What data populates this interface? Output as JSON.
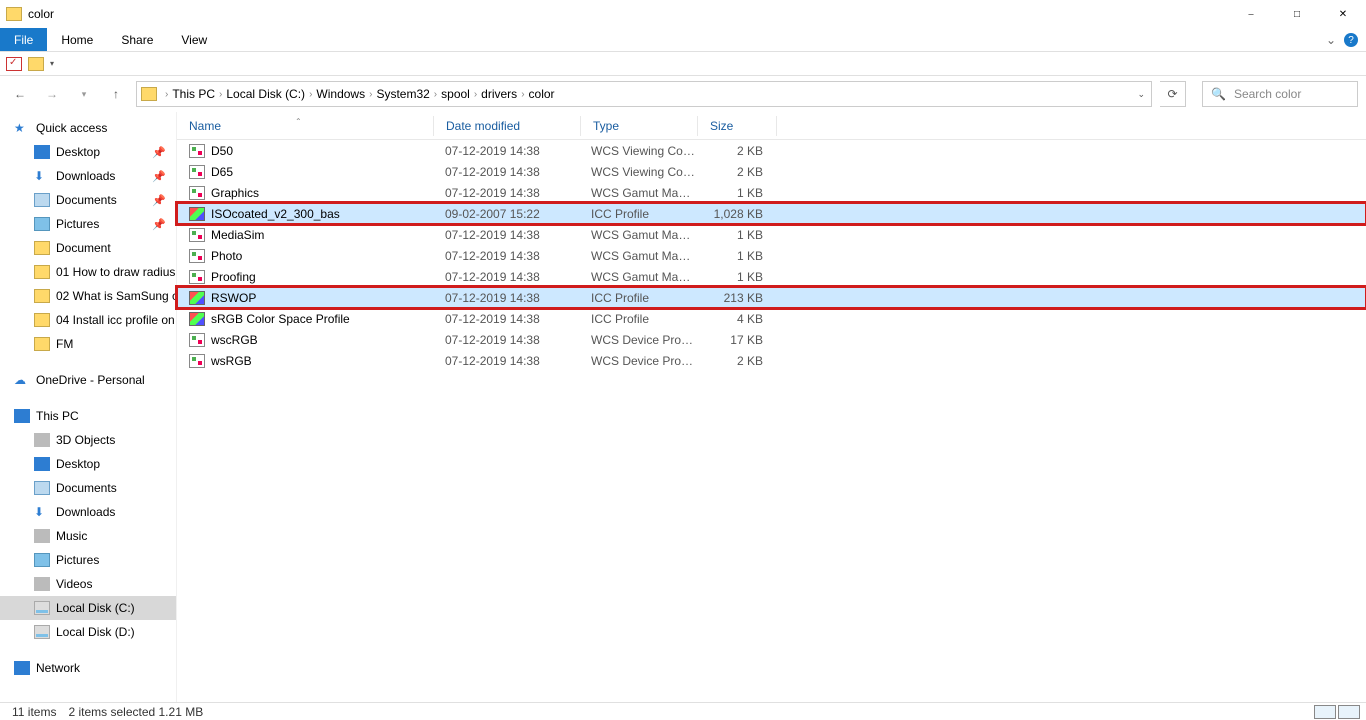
{
  "window": {
    "title": "color"
  },
  "ribbon": {
    "file": "File",
    "tabs": [
      "Home",
      "Share",
      "View"
    ]
  },
  "breadcrumb": {
    "parts": [
      "This PC",
      "Local Disk (C:)",
      "Windows",
      "System32",
      "spool",
      "drivers",
      "color"
    ]
  },
  "search": {
    "placeholder": "Search color"
  },
  "navpane": {
    "quick_access": "Quick access",
    "pinned": [
      {
        "icon": "mon",
        "label": "Desktop"
      },
      {
        "icon": "dl",
        "label": "Downloads"
      },
      {
        "icon": "doc",
        "label": "Documents"
      },
      {
        "icon": "pic",
        "label": "Pictures"
      }
    ],
    "freq": [
      {
        "label": "Document"
      },
      {
        "label": "01 How to draw radius"
      },
      {
        "label": "02 What is SamSung c"
      },
      {
        "label": "04 Install icc profile on"
      },
      {
        "label": "FM"
      }
    ],
    "onedrive": "OneDrive - Personal",
    "this_pc": "This PC",
    "pc_children": [
      {
        "icon": "pc",
        "label": "3D Objects"
      },
      {
        "icon": "mon",
        "label": "Desktop"
      },
      {
        "icon": "doc",
        "label": "Documents"
      },
      {
        "icon": "dl",
        "label": "Downloads"
      },
      {
        "icon": "pc",
        "label": "Music"
      },
      {
        "icon": "pic",
        "label": "Pictures"
      },
      {
        "icon": "pc",
        "label": "Videos"
      },
      {
        "icon": "drv",
        "label": "Local Disk (C:)",
        "sel": true
      },
      {
        "icon": "drv",
        "label": "Local Disk (D:)"
      }
    ],
    "network": "Network"
  },
  "columns": {
    "name": "Name",
    "date": "Date modified",
    "type": "Type",
    "size": "Size"
  },
  "files": [
    {
      "ico": "wcs",
      "name": "D50",
      "date": "07-12-2019 14:38",
      "type": "WCS Viewing Con...",
      "size": "2 KB"
    },
    {
      "ico": "wcs",
      "name": "D65",
      "date": "07-12-2019 14:38",
      "type": "WCS Viewing Con...",
      "size": "2 KB"
    },
    {
      "ico": "wcs",
      "name": "Graphics",
      "date": "07-12-2019 14:38",
      "type": "WCS Gamut Map...",
      "size": "1 KB"
    },
    {
      "ico": "icc",
      "name": "ISOcoated_v2_300_bas",
      "date": "09-02-2007 15:22",
      "type": "ICC Profile",
      "size": "1,028 KB",
      "sel": true,
      "hl": true
    },
    {
      "ico": "wcs",
      "name": "MediaSim",
      "date": "07-12-2019 14:38",
      "type": "WCS Gamut Map...",
      "size": "1 KB"
    },
    {
      "ico": "wcs",
      "name": "Photo",
      "date": "07-12-2019 14:38",
      "type": "WCS Gamut Map...",
      "size": "1 KB"
    },
    {
      "ico": "wcs",
      "name": "Proofing",
      "date": "07-12-2019 14:38",
      "type": "WCS Gamut Map...",
      "size": "1 KB"
    },
    {
      "ico": "icc",
      "name": "RSWOP",
      "date": "07-12-2019 14:38",
      "type": "ICC Profile",
      "size": "213 KB",
      "sel": true,
      "hl": true
    },
    {
      "ico": "icc",
      "name": "sRGB Color Space Profile",
      "date": "07-12-2019 14:38",
      "type": "ICC Profile",
      "size": "4 KB"
    },
    {
      "ico": "wcs",
      "name": "wscRGB",
      "date": "07-12-2019 14:38",
      "type": "WCS Device Profile",
      "size": "17 KB"
    },
    {
      "ico": "wcs",
      "name": "wsRGB",
      "date": "07-12-2019 14:38",
      "type": "WCS Device Profile",
      "size": "2 KB"
    }
  ],
  "status": {
    "count": "11 items",
    "selection": "2 items selected  1.21 MB"
  }
}
